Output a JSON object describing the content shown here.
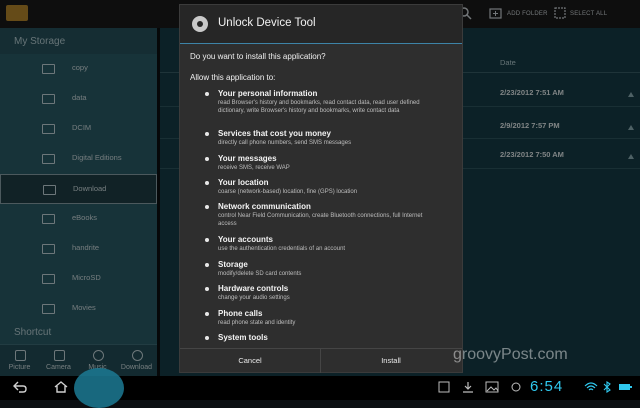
{
  "topbar": {
    "add_folder_label": "ADD FOLDER",
    "select_all_label": "SELECT ALL",
    "icons": [
      "folder-icon",
      "search-icon",
      "add-folder-icon",
      "select-all-icon"
    ]
  },
  "sidebar": {
    "title": "My Storage",
    "items": [
      {
        "label": "copy"
      },
      {
        "label": "data"
      },
      {
        "label": "DCIM"
      },
      {
        "label": "Digital Editions"
      },
      {
        "label": "Download",
        "selected": true
      },
      {
        "label": "eBooks"
      },
      {
        "label": "handrite"
      },
      {
        "label": "MicroSD"
      },
      {
        "label": "Movies"
      }
    ],
    "shortcut_title": "Shortcut",
    "tabs": [
      {
        "label": "Picture"
      },
      {
        "label": "Camera"
      },
      {
        "label": "Music"
      },
      {
        "label": "Download"
      }
    ]
  },
  "content": {
    "date_header": "Date",
    "dates": [
      "2/23/2012 7:51 AM",
      "2/9/2012 7:57 PM",
      "2/23/2012 7:50 AM"
    ]
  },
  "dialog": {
    "title": "Unlock Device Tool",
    "question": "Do you want to install this application?",
    "allow": "Allow this application to:",
    "permissions": [
      {
        "title": "Your personal information",
        "desc": "read Browser's history and bookmarks, read contact data, read user defined dictionary, write Browser's history and bookmarks, write contact data"
      },
      {
        "title": "Services that cost you money",
        "desc": "directly call phone numbers, send SMS messages"
      },
      {
        "title": "Your messages",
        "desc": "receive SMS, receive WAP"
      },
      {
        "title": "Your location",
        "desc": "coarse (network-based) location, fine (GPS) location"
      },
      {
        "title": "Network communication",
        "desc": "control Near Field Communication, create Bluetooth connections, full Internet access"
      },
      {
        "title": "Your accounts",
        "desc": "use the authentication credentials of an account"
      },
      {
        "title": "Storage",
        "desc": "modify/delete SD card contents"
      },
      {
        "title": "Hardware controls",
        "desc": "change your audio settings"
      },
      {
        "title": "Phone calls",
        "desc": "read phone state and identity"
      },
      {
        "title": "System tools",
        "desc": ""
      }
    ],
    "cancel_label": "Cancel",
    "install_label": "Install"
  },
  "system_bar": {
    "clock": "6:54"
  },
  "watermark": "groovyPost.com",
  "colors": {
    "sidebar": "#2b5d69",
    "content": "#173d47",
    "dialog": "#2e2e2e",
    "accent": "#30c9ef"
  }
}
